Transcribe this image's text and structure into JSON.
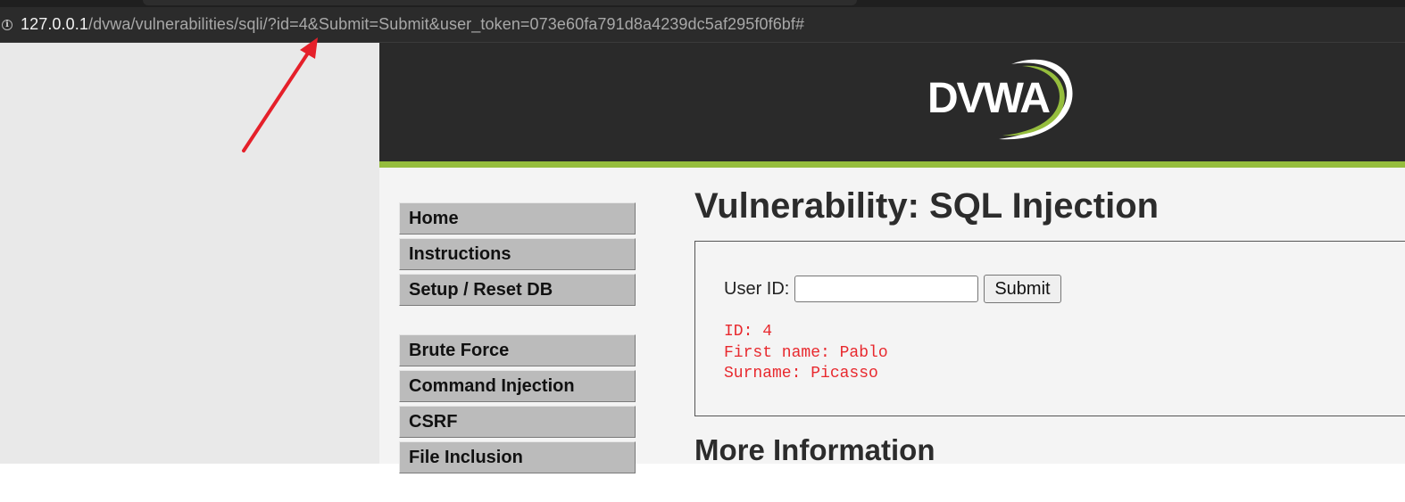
{
  "browser": {
    "url_host": "127.0.0.1",
    "url_path": "/dvwa/vulnerabilities/sqli/?id=4&Submit=Submit&user_token=073e60fa791d8a4239dc5af295f0f6bf#",
    "info_icon": "info-icon"
  },
  "logo": {
    "text": "DVWA"
  },
  "menu": {
    "group1": [
      "Home",
      "Instructions",
      "Setup / Reset DB"
    ],
    "group2": [
      "Brute Force",
      "Command Injection",
      "CSRF",
      "File Inclusion"
    ]
  },
  "main": {
    "title": "Vulnerability: SQL Injection",
    "form": {
      "label": "User ID:",
      "input_value": "",
      "submit_label": "Submit"
    },
    "result": {
      "id_line": "ID: 4",
      "first_name_line": "First name: Pablo",
      "surname_line": "Surname: Picasso"
    },
    "more_info_heading": "More Information"
  },
  "colors": {
    "accent_green": "#95bd3d",
    "result_red": "#e8292e",
    "header_bg": "#2a2a2a",
    "annotation_arrow": "#e5202a"
  }
}
